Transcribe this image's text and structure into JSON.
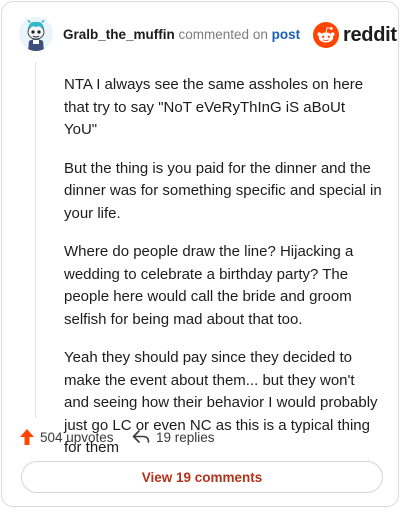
{
  "header": {
    "username": "Gralb_the_muffin",
    "action_text": "commented on",
    "post_link": "post",
    "brand": "reddit"
  },
  "comment": {
    "paragraphs": [
      "NTA I always see the same assholes on here that try to say \"NoT eVeRyThInG iS aBoUt YoU\"",
      "But the thing is you paid for the dinner and the dinner was for something specific and special in your life.",
      "Where do people draw the line? Hijacking a wedding to celebrate a birthday party? The people here would call the bride and groom selfish for being mad about that too.",
      "Yeah they should pay since they decided to make the event about them... but they won't and seeing how their behavior I would probably just go LC or even NC as this is a typical thing for them"
    ]
  },
  "actions": {
    "upvotes": "504 upvotes",
    "replies": "19 replies"
  },
  "footer": {
    "view_comments": "View 19 comments"
  },
  "colors": {
    "brand_orange": "#ff4500",
    "link_blue": "#1a5fb4",
    "view_text": "#b3321a"
  },
  "icons": {
    "avatar": "snoo-avatar",
    "logo": "reddit-snoo-icon",
    "upvote": "upvote-arrow-icon",
    "reply": "reply-arrow-icon"
  }
}
